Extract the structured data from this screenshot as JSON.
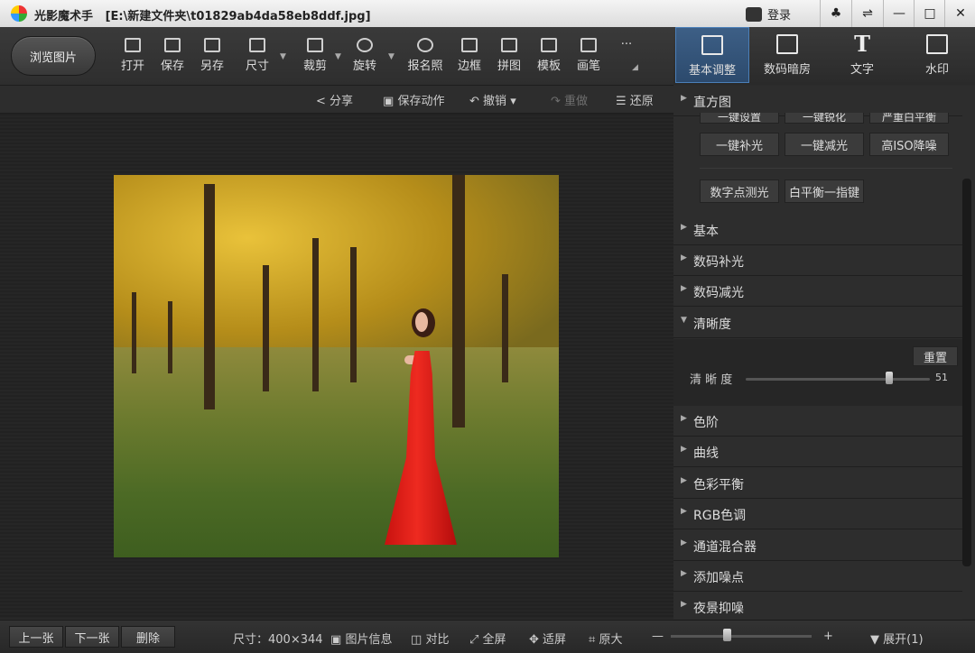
{
  "titlebar": {
    "app_name": "光影魔术手",
    "file_path": "[E:\\新建文件夹\\t01829ab4da58eb8ddf.jpg]",
    "login_label": "登录",
    "buttons": [
      "♣",
      "⇌",
      "—",
      "□",
      "✕"
    ]
  },
  "toolbar": {
    "browse_label": "浏览图片",
    "tools": [
      {
        "label": "打开",
        "icon": "open-image-icon"
      },
      {
        "label": "保存",
        "icon": "save-icon"
      },
      {
        "label": "另存",
        "icon": "save-as-icon"
      },
      {
        "label": "尺寸",
        "icon": "resize-icon"
      },
      {
        "label": "裁剪",
        "icon": "crop-icon"
      },
      {
        "label": "旋转",
        "icon": "rotate-icon"
      },
      {
        "label": "报名照",
        "icon": "id-photo-icon"
      },
      {
        "label": "边框",
        "icon": "border-icon"
      },
      {
        "label": "拼图",
        "icon": "collage-icon"
      },
      {
        "label": "模板",
        "icon": "template-icon"
      },
      {
        "label": "画笔",
        "icon": "brush-icon"
      }
    ],
    "more_label": "···"
  },
  "right_tabs": [
    {
      "label": "基本调整",
      "icon": "basic-adjust-icon"
    },
    {
      "label": "数码暗房",
      "icon": "darkroom-icon"
    },
    {
      "label": "文字",
      "icon": "text-icon"
    },
    {
      "label": "水印",
      "icon": "watermark-icon"
    }
  ],
  "actionbar": {
    "share": "分享",
    "save_action": "保存动作",
    "undo": "撤销",
    "redo": "重做",
    "restore": "还原"
  },
  "right_panel": {
    "histogram_title": "直方图",
    "cut_buttons": [
      "一键设置",
      "一键锐化",
      "严重白平衡"
    ],
    "quick_buttons": [
      "一键补光",
      "一键减光",
      "高ISO降噪"
    ],
    "quick_buttons2": [
      "数字点测光",
      "白平衡一指键"
    ],
    "sections_top": [
      "基本",
      "数码补光",
      "数码减光"
    ],
    "sharpness_section": "清晰度",
    "reset_label": "重置",
    "sharpness_label": "清 晰 度",
    "sharpness_value": "51",
    "sharpness_fraction": 0.51,
    "sections_bottom": [
      "色阶",
      "曲线",
      "色彩平衡",
      "RGB色调",
      "通道混合器",
      "添加噪点",
      "夜景抑噪"
    ]
  },
  "statusbar": {
    "prev": "上一张",
    "next": "下一张",
    "delete": "删除",
    "size_label": "尺寸：400×344",
    "info": "图片信息",
    "compare": "对比",
    "fullscreen": "全屏",
    "fit": "适屏",
    "original": "原大",
    "zoom_minus": "—",
    "zoom_plus": "+",
    "expand": "展开(1)",
    "zoom_fraction": 0.4
  }
}
